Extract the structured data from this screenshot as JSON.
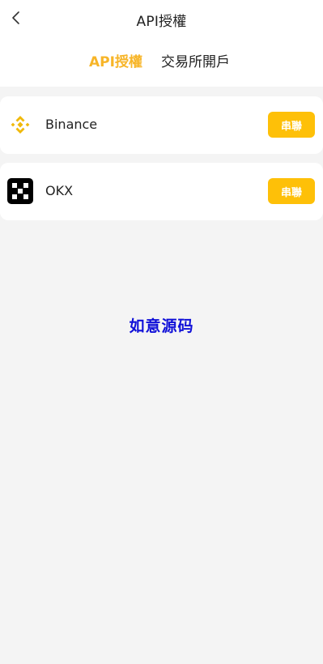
{
  "navbar": {
    "title": "API授權",
    "back_icon": "chevron-left-icon"
  },
  "tabs": [
    {
      "label": "API授權",
      "active": true
    },
    {
      "label": "交易所開戶",
      "active": false
    }
  ],
  "exchanges": [
    {
      "name": "Binance",
      "logo_icon": "binance-logo-icon",
      "button_label": "串聯"
    },
    {
      "name": "OKX",
      "logo_icon": "okx-logo-icon",
      "button_label": "串聯"
    }
  ],
  "watermark": "如意源码",
  "colors": {
    "accent_tab": "#f7b528",
    "button_bg": "#fec008",
    "binance_yellow": "#f0b90b",
    "watermark": "#1010d8",
    "background": "#f4f4f4"
  }
}
